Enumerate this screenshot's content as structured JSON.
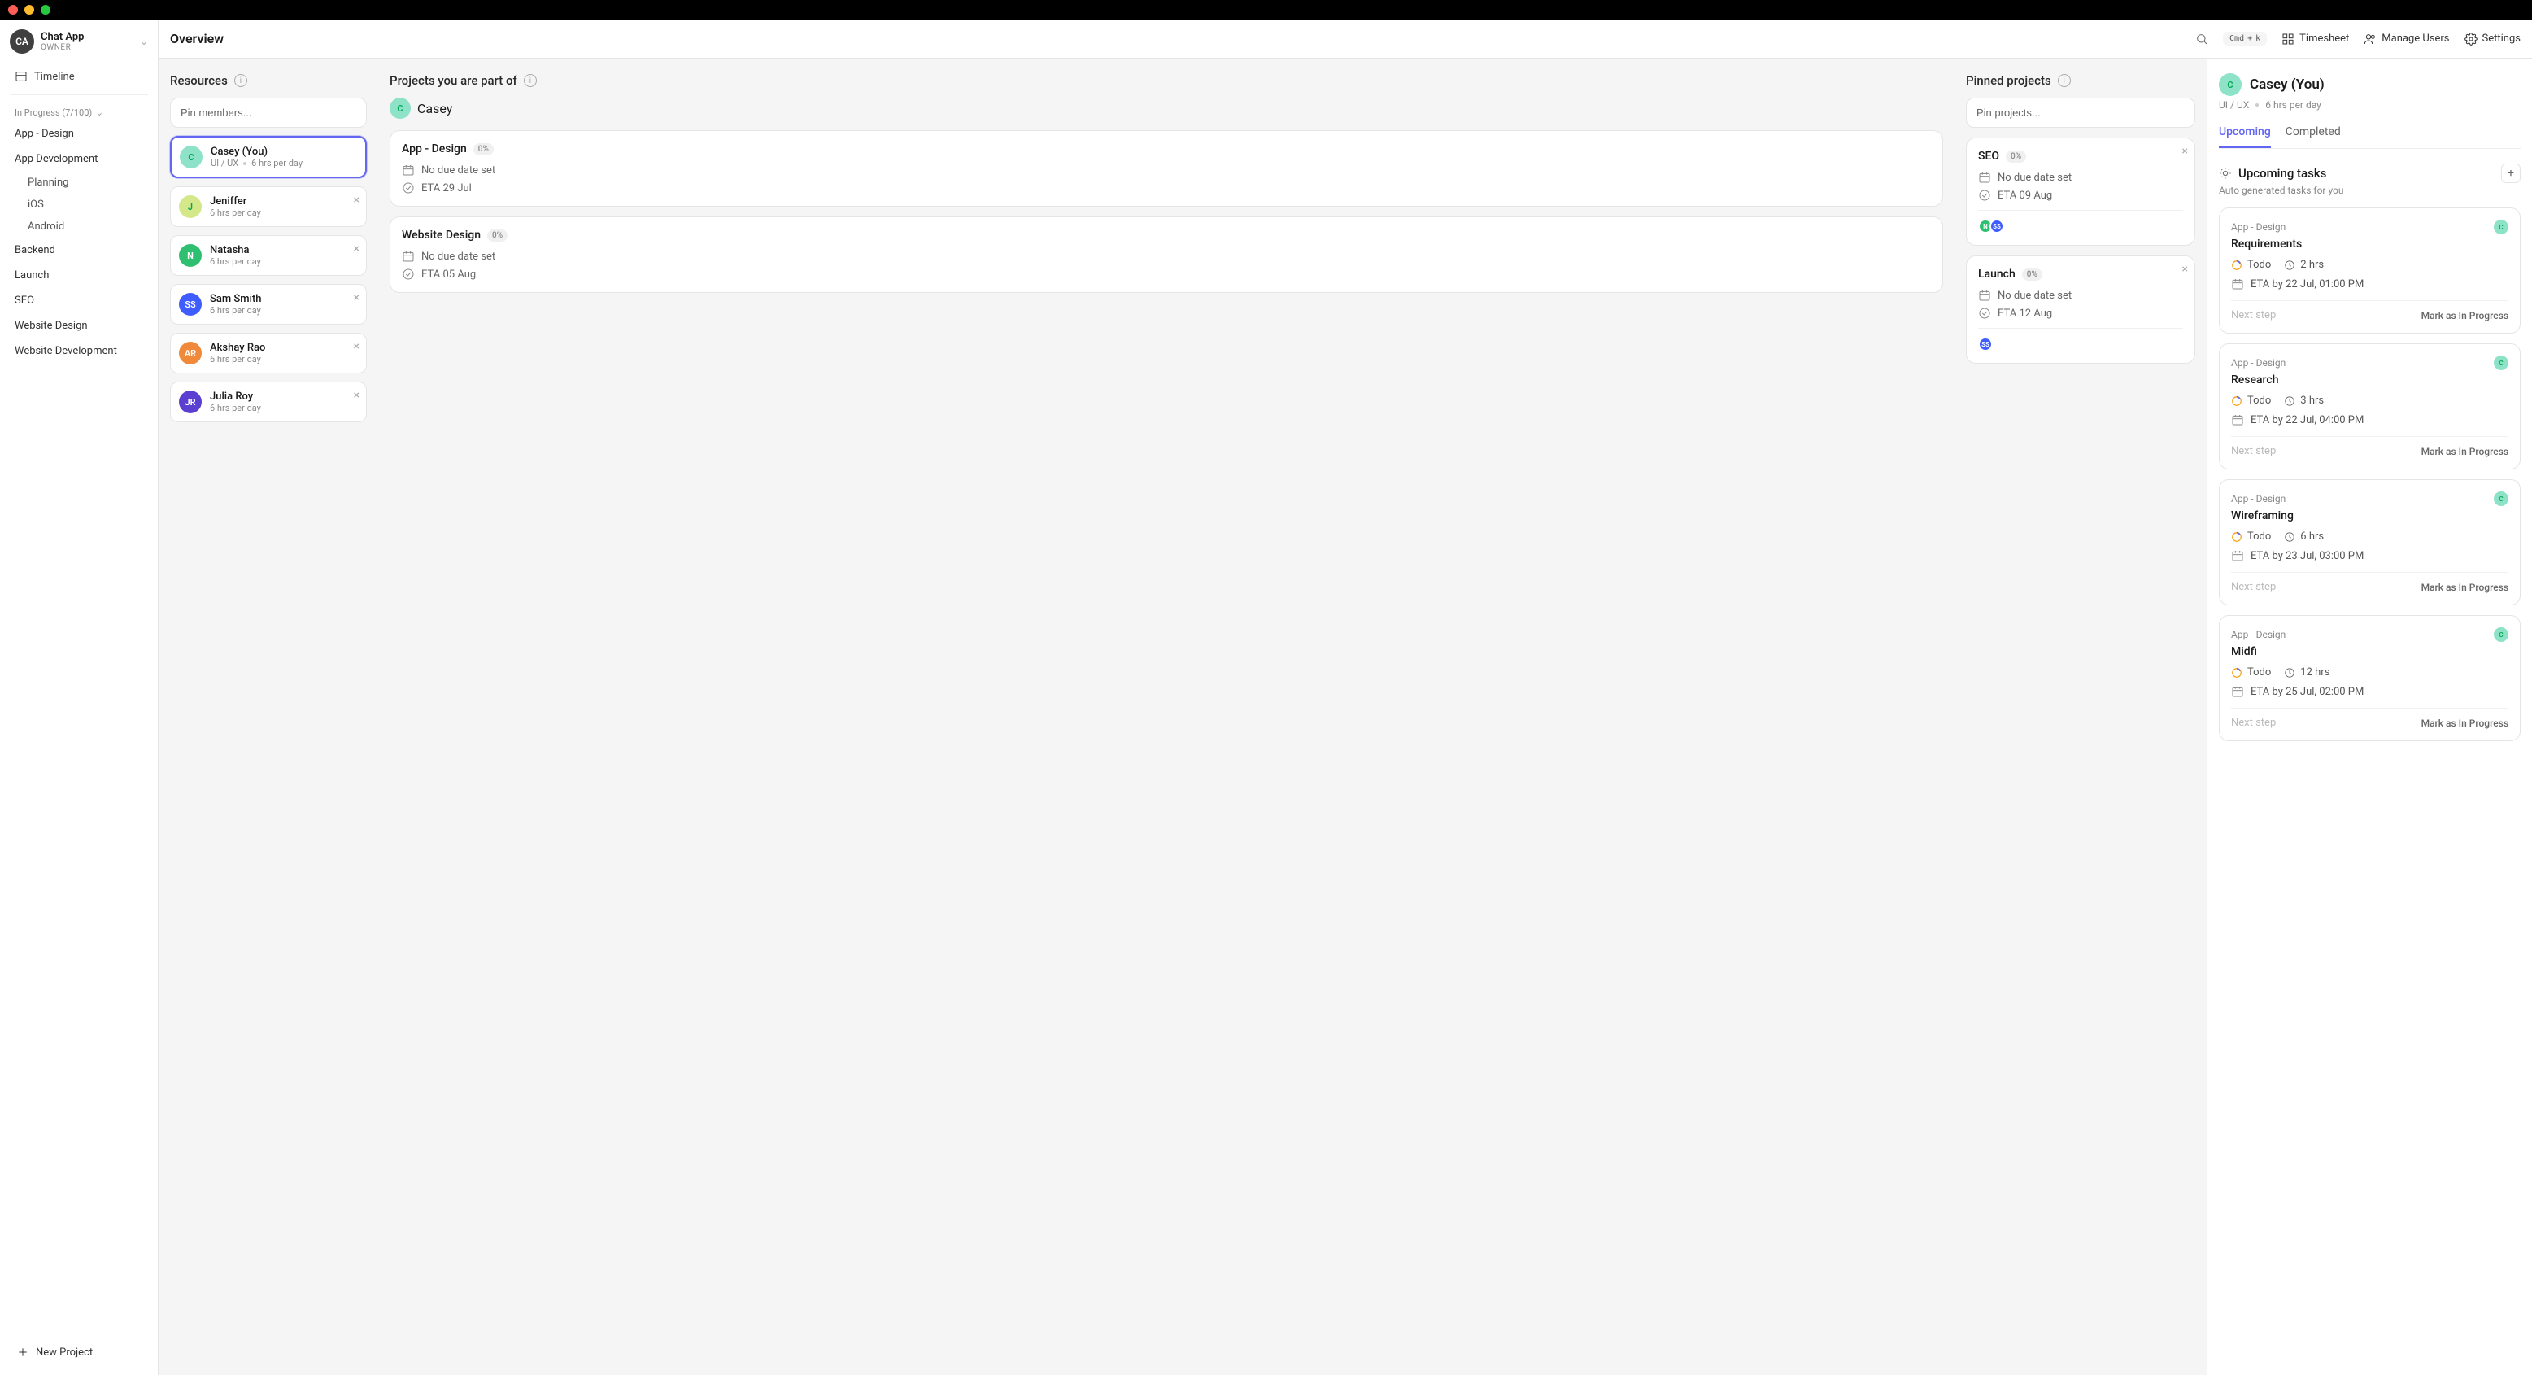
{
  "workspace": {
    "avatar": "CA",
    "name": "Chat App",
    "role": "OWNER"
  },
  "sidebar": {
    "timeline": "Timeline",
    "section_header": "In Progress (7/100)",
    "projects": [
      {
        "name": "App - Design",
        "children": []
      },
      {
        "name": "App Development",
        "children": [
          "Planning",
          "iOS",
          "Android"
        ]
      },
      {
        "name": "Backend",
        "children": []
      },
      {
        "name": "Launch",
        "children": []
      },
      {
        "name": "SEO",
        "children": []
      },
      {
        "name": "Website Design",
        "children": []
      },
      {
        "name": "Website Development",
        "children": []
      }
    ],
    "new_project": "New Project"
  },
  "topbar": {
    "title": "Overview",
    "cmd": "Cmd",
    "plus": "+",
    "k": "k",
    "timesheet": "Timesheet",
    "manage_users": "Manage Users",
    "settings": "Settings"
  },
  "resources": {
    "title": "Resources",
    "pin_placeholder": "Pin members...",
    "items": [
      {
        "initials": "C",
        "color": "#8de2c7",
        "name": "Casey (You)",
        "role": "UI / UX",
        "hours": "6 hrs per day",
        "selected": true,
        "closable": false
      },
      {
        "initials": "J",
        "color": "#d4e88a",
        "name": "Jeniffer",
        "role": "",
        "hours": "6 hrs per day",
        "selected": false,
        "closable": true
      },
      {
        "initials": "N",
        "color": "#2fbf71",
        "name": "Natasha",
        "role": "",
        "hours": "6 hrs per day",
        "selected": false,
        "closable": true
      },
      {
        "initials": "SS",
        "color": "#3f5cff",
        "name": "Sam Smith",
        "role": "",
        "hours": "6 hrs per day",
        "selected": false,
        "closable": true
      },
      {
        "initials": "AR",
        "color": "#f0893a",
        "name": "Akshay Rao",
        "role": "",
        "hours": "6 hrs per day",
        "selected": false,
        "closable": true
      },
      {
        "initials": "JR",
        "color": "#5b3fd1",
        "name": "Julia Roy",
        "role": "",
        "hours": "6 hrs per day",
        "selected": false,
        "closable": true
      }
    ]
  },
  "projects_part_of": {
    "title": "Projects you are part of",
    "member": {
      "initials": "C",
      "color": "#8de2c7",
      "name": "Casey"
    },
    "cards": [
      {
        "title": "App - Design",
        "badge": "0%",
        "due": "No due date set",
        "eta": "ETA 29 Jul"
      },
      {
        "title": "Website Design",
        "badge": "0%",
        "due": "No due date set",
        "eta": "ETA 05 Aug"
      }
    ]
  },
  "pinned": {
    "title": "Pinned projects",
    "pin_placeholder": "Pin projects...",
    "cards": [
      {
        "title": "SEO",
        "badge": "0%",
        "due": "No due date set",
        "eta": "ETA 09 Aug",
        "members": [
          {
            "i": "N",
            "c": "#2fbf71"
          },
          {
            "i": "SS",
            "c": "#3f5cff"
          }
        ]
      },
      {
        "title": "Launch",
        "badge": "0%",
        "due": "No due date set",
        "eta": "ETA 12 Aug",
        "members": [
          {
            "i": "SS",
            "c": "#3f5cff"
          }
        ]
      }
    ]
  },
  "detail": {
    "avatar": {
      "initials": "C",
      "color": "#8de2c7"
    },
    "name": "Casey (You)",
    "role": "UI / UX",
    "hours": "6 hrs per day",
    "tabs": {
      "upcoming": "Upcoming",
      "completed": "Completed"
    },
    "upcoming_title": "Upcoming tasks",
    "upcoming_sub": "Auto generated tasks for you",
    "tasks": [
      {
        "project": "App - Design",
        "title": "Requirements",
        "status": "Todo",
        "hours": "2 hrs",
        "eta": "ETA by 22 Jul, 01:00 PM",
        "next": "Next step",
        "mark": "Mark as In Progress",
        "assignee": {
          "i": "C",
          "c": "#8de2c7"
        }
      },
      {
        "project": "App - Design",
        "title": "Research",
        "status": "Todo",
        "hours": "3 hrs",
        "eta": "ETA by 22 Jul, 04:00 PM",
        "next": "Next step",
        "mark": "Mark as In Progress",
        "assignee": {
          "i": "C",
          "c": "#8de2c7"
        }
      },
      {
        "project": "App - Design",
        "title": "Wireframing",
        "status": "Todo",
        "hours": "6 hrs",
        "eta": "ETA by 23 Jul, 03:00 PM",
        "next": "Next step",
        "mark": "Mark as In Progress",
        "assignee": {
          "i": "C",
          "c": "#8de2c7"
        }
      },
      {
        "project": "App - Design",
        "title": "Midfi",
        "status": "Todo",
        "hours": "12 hrs",
        "eta": "ETA by 25 Jul, 02:00 PM",
        "next": "Next step",
        "mark": "Mark as In Progress",
        "assignee": {
          "i": "C",
          "c": "#8de2c7"
        }
      }
    ]
  }
}
